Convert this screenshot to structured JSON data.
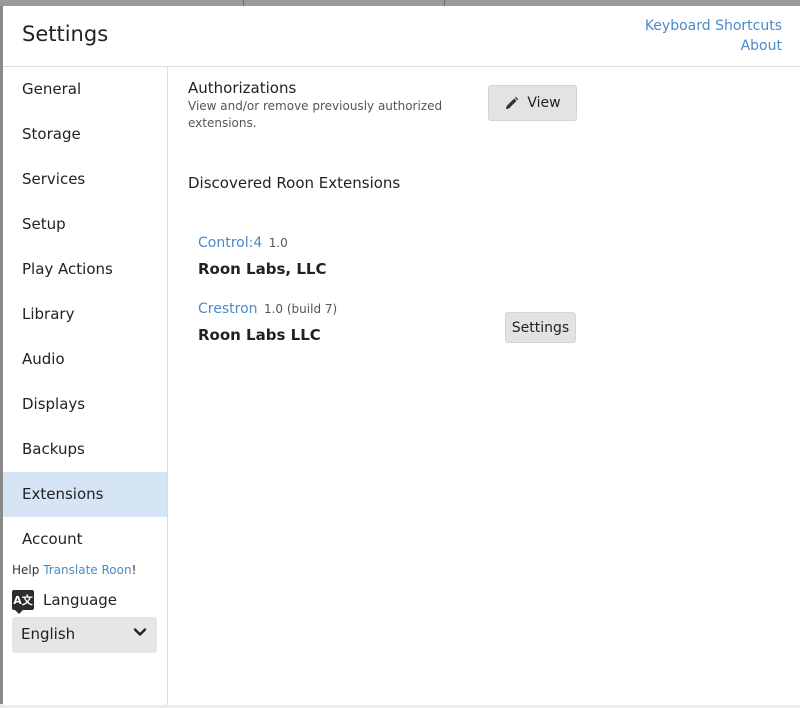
{
  "header": {
    "title": "Settings",
    "keyboard_shortcuts": "Keyboard Shortcuts",
    "about": "About"
  },
  "sidebar": {
    "items": [
      {
        "label": "General"
      },
      {
        "label": "Storage"
      },
      {
        "label": "Services"
      },
      {
        "label": "Setup"
      },
      {
        "label": "Play Actions"
      },
      {
        "label": "Library"
      },
      {
        "label": "Audio"
      },
      {
        "label": "Displays"
      },
      {
        "label": "Backups"
      },
      {
        "label": "Extensions",
        "active": true
      },
      {
        "label": "Account"
      }
    ],
    "help_prefix": "Help",
    "help_link": "Translate Roon",
    "help_suffix": "!",
    "language_label": "Language",
    "language_icon": "translate-icon",
    "language_value": "English"
  },
  "main": {
    "authorizations": {
      "title": "Authorizations",
      "description": "View and/or remove previously authorized extensions.",
      "view_button": "View",
      "view_icon": "pencil-icon"
    },
    "section_title": "Discovered Roon Extensions",
    "extensions": [
      {
        "name": "Control:4",
        "version": "1.0",
        "publisher": "Roon Labs, LLC"
      },
      {
        "name": "Crestron",
        "version": "1.0 (build 7)",
        "publisher": "Roon Labs LLC",
        "button": "Settings"
      }
    ]
  },
  "colors": {
    "accent": "#4a8bc9",
    "active_nav": "#d6e5f5",
    "button_bg": "#e3e3e3"
  }
}
